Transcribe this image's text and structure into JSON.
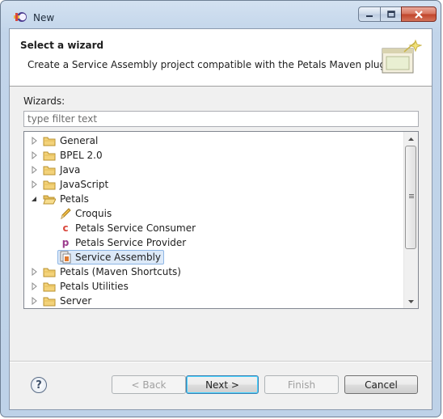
{
  "window": {
    "title": "New",
    "colors": {
      "title_bar": "#c2d5ea",
      "close_button": "#c0432a",
      "selection": "#dce9f8"
    }
  },
  "header": {
    "title": "Select a wizard",
    "description": "Create a Service Assembly project compatible with the Petals Maven plug-in",
    "icon": "wizard-banner-icon"
  },
  "wizards": {
    "label": "Wizards:",
    "filter_placeholder": "type filter text",
    "tree": [
      {
        "label": "General",
        "type": "folder",
        "expanded": false,
        "level": 0,
        "icon": "folder-icon"
      },
      {
        "label": "BPEL 2.0",
        "type": "folder",
        "expanded": false,
        "level": 0,
        "icon": "folder-icon"
      },
      {
        "label": "Java",
        "type": "folder",
        "expanded": false,
        "level": 0,
        "icon": "folder-icon"
      },
      {
        "label": "JavaScript",
        "type": "folder",
        "expanded": false,
        "level": 0,
        "icon": "folder-icon"
      },
      {
        "label": "Petals",
        "type": "folder",
        "expanded": true,
        "level": 0,
        "icon": "folder-icon"
      },
      {
        "label": "Croquis",
        "type": "item",
        "level": 1,
        "icon": "pencil-icon"
      },
      {
        "label": "Petals Service Consumer",
        "type": "item",
        "level": 1,
        "icon": "consumer-c-icon"
      },
      {
        "label": "Petals Service Provider",
        "type": "item",
        "level": 1,
        "icon": "provider-p-icon"
      },
      {
        "label": "Service Assembly",
        "type": "item",
        "level": 1,
        "icon": "service-assembly-icon",
        "selected": true
      },
      {
        "label": "Petals (Maven Shortcuts)",
        "type": "folder",
        "expanded": false,
        "level": 0,
        "icon": "folder-icon"
      },
      {
        "label": "Petals Utilities",
        "type": "folder",
        "expanded": false,
        "level": 0,
        "icon": "folder-icon"
      },
      {
        "label": "Server",
        "type": "folder",
        "expanded": false,
        "level": 0,
        "icon": "folder-icon"
      }
    ]
  },
  "buttons": {
    "help": "?",
    "back": "< Back",
    "next": "Next >",
    "finish": "Finish",
    "cancel": "Cancel"
  }
}
